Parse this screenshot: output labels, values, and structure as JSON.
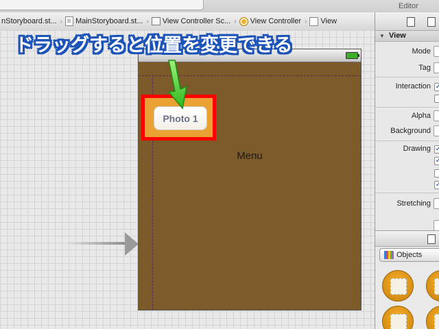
{
  "top_bar": {
    "right_label": "Editor"
  },
  "jump_bar": {
    "crumbs": [
      {
        "label": "nStoryboard.st...",
        "icon": "storyboard-file-icon"
      },
      {
        "label": "MainStoryboard.st...",
        "icon": "storyboard-file-icon"
      },
      {
        "label": "View Controller Sc...",
        "icon": "scene-icon"
      },
      {
        "label": "View Controller",
        "icon": "view-controller-icon"
      },
      {
        "label": "View",
        "icon": "view-icon"
      }
    ]
  },
  "annotation": {
    "text": "ドラッグすると位置を変更できる",
    "color": "#ffffff",
    "outline_color": "#1d54b8"
  },
  "scene": {
    "background_color": "#7d5a2a",
    "menu_label": "Menu",
    "photo_button_label": "Photo 1",
    "highlight_color": "#ff0000"
  },
  "inspector": {
    "section_title": "View",
    "rows": {
      "mode": "Mode",
      "tag": "Tag",
      "interaction": "Interaction",
      "alpha": "Alpha",
      "background": "Background",
      "drawing": "Drawing",
      "stretching": "Stretching"
    },
    "library_picker_label": "Objects"
  },
  "icons": {
    "battery": "battery-icon",
    "arrow": "green-arrow-icon",
    "books": "books-icon"
  }
}
